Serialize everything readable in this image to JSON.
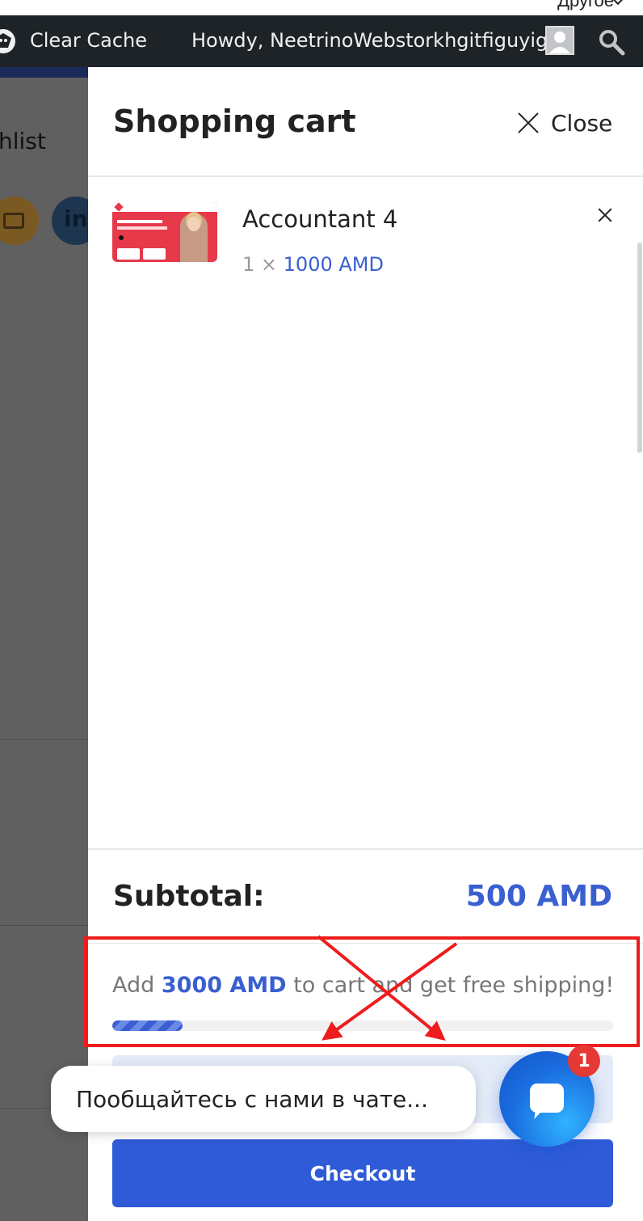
{
  "top_bar": {
    "language_label": "Другое"
  },
  "admin_bar": {
    "clear_cache_label": "Clear Cache",
    "greeting": "Howdy, NeetrinoWebstorkhgitfiguyig",
    "icons": [
      "logo-icon",
      "avatar",
      "search-icon"
    ]
  },
  "background_page": {
    "wishlist_fragment": "hlist"
  },
  "cart": {
    "title": "Shopping cart",
    "close_label": "Close",
    "items": [
      {
        "name": "Accountant 4",
        "quantity": "1 ×",
        "price": "1000 AMD"
      }
    ],
    "subtotal_label": "Subtotal:",
    "subtotal_value": "500 AMD",
    "free_shipping": {
      "prefix": "Add",
      "amount": "3000 AMD",
      "suffix": "to cart and get free shipping!",
      "progress_percent": 14
    },
    "checkout_label": "Checkout"
  },
  "chat": {
    "bubble_text": "Пообщайтесь с нами в чате...",
    "badge_count": "1"
  },
  "colors": {
    "accent": "#3a5fd0",
    "checkout_bg": "#2f5bd8",
    "admin_bar_bg": "#1d2327",
    "annotation": "#ee1c1c"
  }
}
